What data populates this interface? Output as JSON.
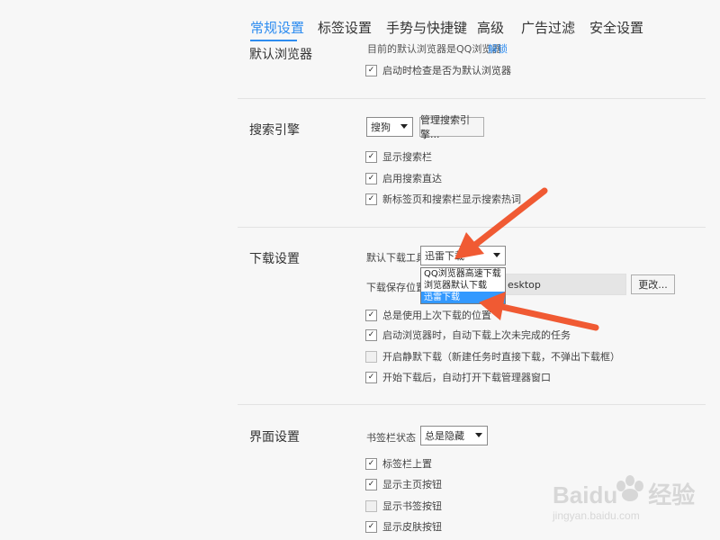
{
  "tabs": [
    {
      "label": "常规设置",
      "active": true
    },
    {
      "label": "标签设置",
      "active": false
    },
    {
      "label": "手势与快捷键",
      "active": false
    },
    {
      "label": "高级",
      "active": false
    },
    {
      "label": "广告过滤",
      "active": false
    },
    {
      "label": "安全设置",
      "active": false
    }
  ],
  "default_browser": {
    "title": "默认浏览器",
    "status_text": "目前的默认浏览器是QQ浏览器",
    "link_text": "解锁",
    "check_on_start": "启动时检查是否为默认浏览器"
  },
  "search": {
    "title": "搜索引擎",
    "engine_value": "搜狗",
    "manage_button": "管理搜索引擎...",
    "options": [
      "显示搜索栏",
      "启用搜索直达",
      "新标签页和搜索栏显示搜索热词"
    ]
  },
  "download": {
    "title": "下载设置",
    "tool_label": "默认下载工具",
    "tool_value": "迅雷下载",
    "tool_options": [
      "QQ浏览器高速下载",
      "浏览器默认下载",
      "迅雷下载"
    ],
    "selected_option": "迅雷下载",
    "path_label": "下载保存位置",
    "path_value": "esktop",
    "change_button": "更改...",
    "options": [
      {
        "label": "总是使用上次下载的位置",
        "checked": true
      },
      {
        "label": "启动浏览器时，自动下载上次未完成的任务",
        "checked": true
      },
      {
        "label": "开启静默下载（新建任务时直接下载，不弹出下载框）",
        "checked": false
      },
      {
        "label": "开始下载后，自动打开下载管理器窗口",
        "checked": true
      }
    ]
  },
  "interface": {
    "title": "界面设置",
    "bookmark_label": "书签栏状态",
    "bookmark_value": "总是隐藏",
    "options": [
      {
        "label": "标签栏上置",
        "checked": true
      },
      {
        "label": "显示主页按钮",
        "checked": true
      },
      {
        "label": "显示书签按钮",
        "checked": false
      },
      {
        "label": "显示皮肤按钮",
        "checked": true
      }
    ]
  },
  "check_glyph": "✓",
  "watermark": {
    "brand": "Baidu",
    "brand_cn": "经验",
    "url": "jingyan.baidu.com"
  },
  "colors": {
    "accent": "#2d8cf0",
    "arrow": "#f05a33",
    "highlight": "#3399ff"
  }
}
